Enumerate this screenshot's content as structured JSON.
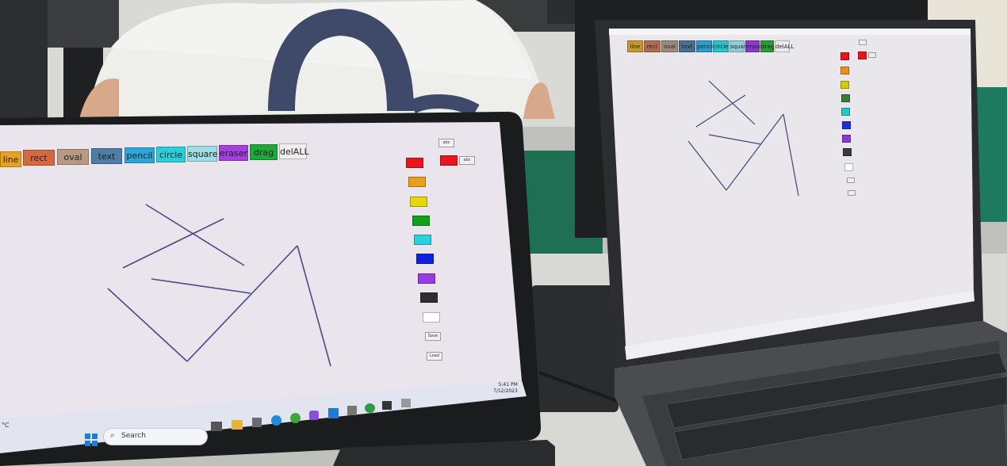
{
  "left_laptop": {
    "toolbar": [
      {
        "label": "line",
        "color": "#e8a31c"
      },
      {
        "label": "rect",
        "color": "#d4693f"
      },
      {
        "label": "oval",
        "color": "#b79a80"
      },
      {
        "label": "text",
        "color": "#4e7ea7"
      },
      {
        "label": "pencil",
        "color": "#2ba6d9"
      },
      {
        "label": "circle",
        "color": "#27cfd9"
      },
      {
        "label": "square",
        "color": "#9fdce3"
      },
      {
        "label": "eraser",
        "color": "#a63fe0"
      },
      {
        "label": "drag",
        "color": "#1fa83a"
      },
      {
        "label": "delALL",
        "color": "#f2eef0"
      }
    ],
    "top_buttons": {
      "small1": "abc",
      "small2": "abc"
    },
    "palette": [
      "#e8141e",
      "#e8a01a",
      "#e6d60a",
      "#12a21a",
      "#27d4dc",
      "#1020e0",
      "#9a3ae4",
      "#2e2e2e",
      "#ffffff"
    ],
    "side_buttons": {
      "save": "Save",
      "load": "Load"
    },
    "taskbar": {
      "search_label": "Search",
      "time": "5:41 PM",
      "date": "7/12/2023",
      "weather": "°C"
    }
  },
  "right_laptop": {
    "toolbar": [
      {
        "label": "line",
        "color": "#c4982a"
      },
      {
        "label": "rect",
        "color": "#b46a52"
      },
      {
        "label": "oval",
        "color": "#9b8a7a"
      },
      {
        "label": "text",
        "color": "#4a6f90"
      },
      {
        "label": "pencil",
        "color": "#2b9ed0"
      },
      {
        "label": "circle",
        "color": "#29c3cc"
      },
      {
        "label": "square",
        "color": "#8fd0d8"
      },
      {
        "label": "eraser",
        "color": "#8a3ac8"
      },
      {
        "label": "drag",
        "color": "#2a9a3a"
      },
      {
        "label": "delALL",
        "color": "#eeeaec"
      }
    ],
    "palette": [
      "#e8141e",
      "#e8901a",
      "#d6c80a",
      "#3a7a3a",
      "#27c4cc",
      "#2030d0",
      "#8a3ad4",
      "#3a3a3a",
      "#ffffff"
    ]
  }
}
